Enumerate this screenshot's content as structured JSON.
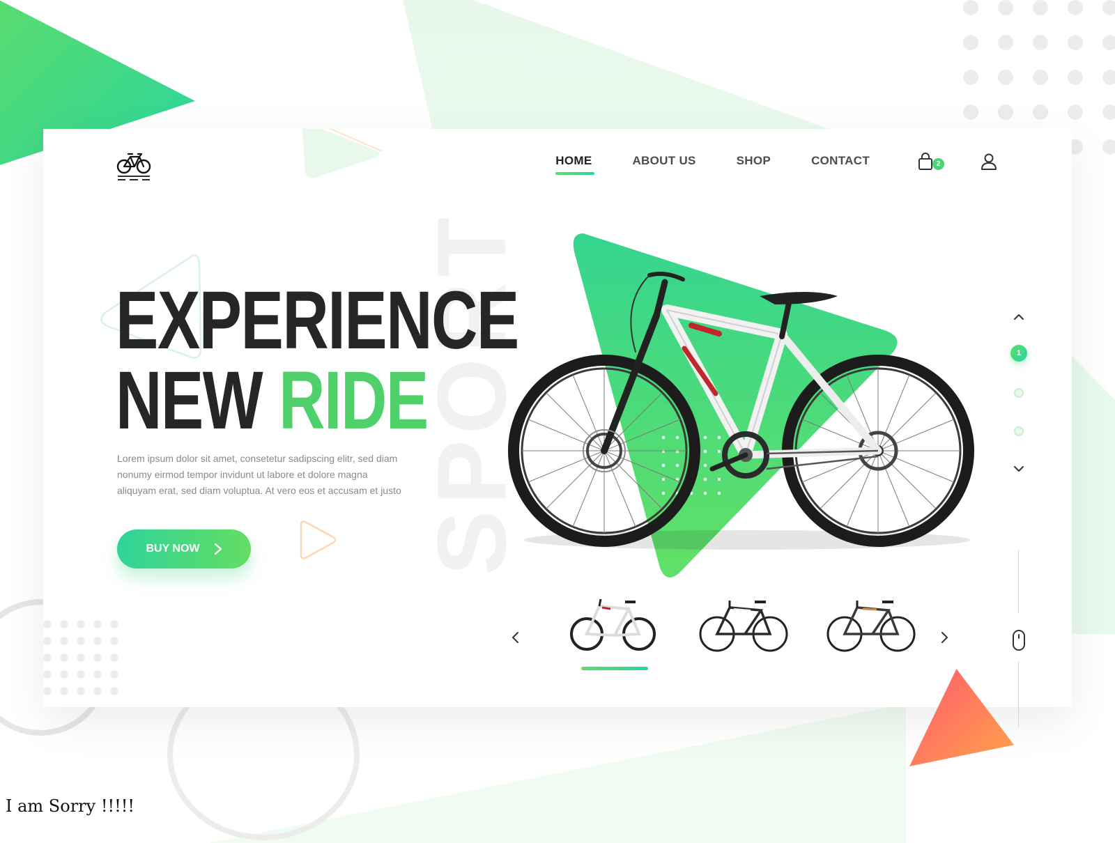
{
  "header": {
    "nav": [
      "HOME",
      "ABOUT US",
      "SHOP",
      "CONTACT"
    ],
    "active_nav": "HOME",
    "cart_count": "2"
  },
  "hero": {
    "title_line1": "EXPERIENCE",
    "title_line2_dark": "NEW",
    "title_line2_accent": "RIDE",
    "body_line1": "Lorem ipsum dolor sit amet, consetetur sadipscing elitr, sed diam",
    "body_line2": "nonumy eirmod tempor invidunt ut labore et dolore magna",
    "body_line3": "aliquyam erat, sed diam voluptua. At vero eos et accusam et justo",
    "cta_label": "BUY NOW",
    "watermark": "SPORT"
  },
  "slider": {
    "active_index": "1",
    "total_dots": 3
  },
  "thumbnails": {
    "count": 3,
    "active": 0
  },
  "colors": {
    "accent_green": "#4fd06a",
    "accent_teal": "#27d69e",
    "orange": "#ffa34a",
    "pink": "#ff5a6e"
  },
  "icons": [
    "bicycle-logo-icon",
    "shopping-bag-icon",
    "user-icon",
    "chevron-up-icon",
    "chevron-down-icon",
    "chevron-left-icon",
    "chevron-right-icon",
    "play-icon",
    "mouse-icon"
  ],
  "note": "I am Sorry !!!!!"
}
